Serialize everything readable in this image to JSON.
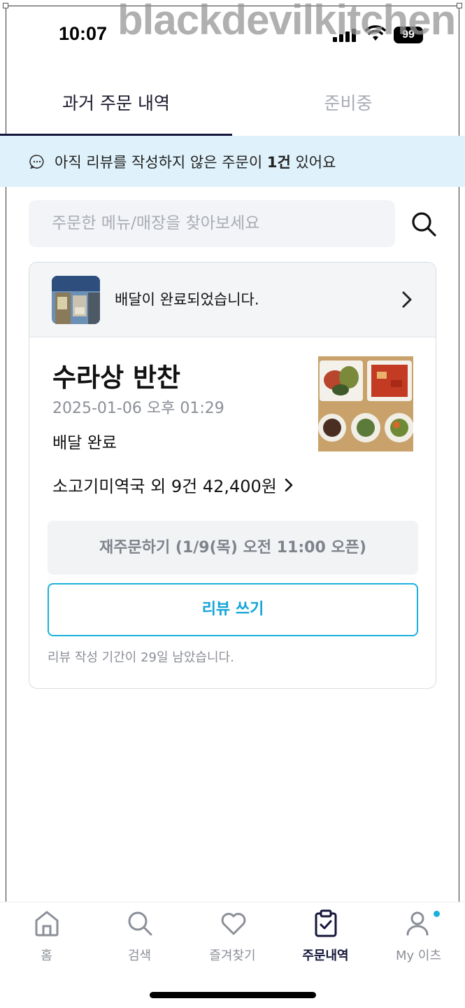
{
  "watermark": "blackdevilkitchen",
  "status_bar": {
    "time": "10:07",
    "battery": "99"
  },
  "tabs": [
    {
      "label": "과거 주문 내역",
      "active": true
    },
    {
      "label": "준비중",
      "active": false
    }
  ],
  "notice": {
    "prefix": "아직 리뷰를 작성하지 않은 주문이 ",
    "count": "1건",
    "suffix": " 있어요"
  },
  "search": {
    "placeholder": "주문한 메뉴/매장을 찾아보세요"
  },
  "order": {
    "delivery_message": "배달이 완료되었습니다.",
    "store_name": "수라상 반찬",
    "date": "2025-01-06 오후 01:29",
    "status": "배달 완료",
    "summary": "소고기미역국 외 9건 42,400원",
    "reorder_label": "재주문하기 (1/9(목) 오전 11:00 오픈)",
    "review_label": "리뷰 쓰기",
    "review_note": "리뷰 작성 기간이 29일 남았습니다."
  },
  "bottom_nav": [
    {
      "label": "홈",
      "icon": "home-icon"
    },
    {
      "label": "검색",
      "icon": "search-icon"
    },
    {
      "label": "즐겨찾기",
      "icon": "heart-icon"
    },
    {
      "label": "주문내역",
      "icon": "clipboard-check-icon",
      "active": true
    },
    {
      "label": "My 이츠",
      "icon": "person-icon"
    }
  ],
  "colors": {
    "accent": "#1bb0dc",
    "notice_bg": "#dff2fb",
    "tab_active": "#15163a"
  }
}
